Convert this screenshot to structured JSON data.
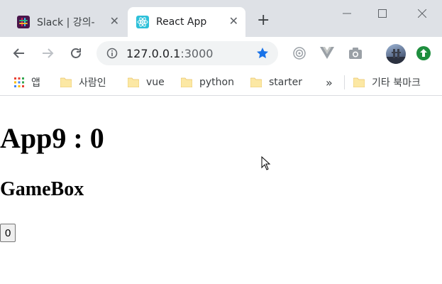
{
  "tabs": [
    {
      "title": "Slack | 강의-",
      "icon": "slack-icon",
      "active": false
    },
    {
      "title": "React App",
      "icon": "react-icon",
      "active": true
    }
  ],
  "omnibox": {
    "host": "127.0.0.1",
    "port": ":3000"
  },
  "bookmarks": {
    "apps_label": "앱",
    "items": [
      "사람인",
      "vue",
      "python",
      "starter"
    ],
    "overflow": "»",
    "other": "기타 북마크"
  },
  "page": {
    "heading": "App9 : 0",
    "subheading": "GameBox",
    "button_label": "0"
  },
  "colors": {
    "tabstrip": "#dee1e6",
    "star": "#1a73e8",
    "update": "#1e8e3e"
  }
}
